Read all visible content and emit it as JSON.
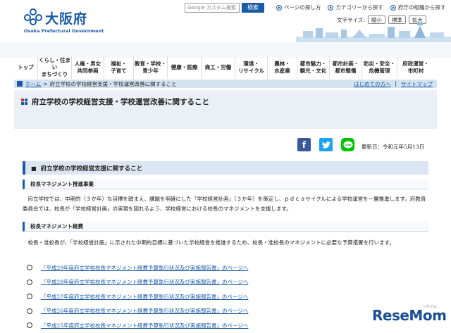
{
  "header": {
    "logo_jp": "大阪府",
    "logo_en": "Osaka Prefectural Government",
    "search_placeholder": "Google カスタム検索",
    "search_button": "検索",
    "util_links": [
      "ページの探し方",
      "カテゴリーから探す",
      "府庁の組織から探す"
    ],
    "font_size_label": "文字サイズ:",
    "font_sizes": [
      "縮小",
      "標準",
      "拡大"
    ]
  },
  "nav": {
    "items": [
      "トップ",
      "くらし・住まい\nまちづくり",
      "人権・男女\n共同参画",
      "福祉・\n子育て",
      "教育・学校・\n青少年",
      "健康・医療",
      "商工・労働",
      "環境・\nリサイクル",
      "農林・\n水産業",
      "都市魅力・\n観光・文化",
      "都市計画・\n都市整備",
      "防災・安全・\n危機管理",
      "府政運営・\n市町村"
    ]
  },
  "breadcrumb": {
    "home": "ホーム",
    "current": "府立学校の学校経営支援・学校運営改善に関すること",
    "right_links": [
      "はじめての方へ",
      "サイトマップ"
    ]
  },
  "page": {
    "title": "府立学校の学校経営支援・学校運営改善に関すること",
    "updated": "更新日：令和元年5月13日",
    "section_title": "府立学校の学校経営支援に関すること",
    "sub1_title": "校長マネジメント推進事業",
    "sub1_text": "府立学校では、中期的（３か年）な目標を踏まえ、課題を明確にした「学校経営計画」（３か年）を策定し、ｐｄｃａサイクルによる学校運営を一層推進します。府教育委員会では、校長が「学校経営計画」の実現を図れるよう、学校経営における校長のマネジメントを支援します。",
    "sub2_title": "校長マネジメント経費",
    "sub2_text": "校長・准校長が、「学校経営計画」に示された中期的目標に基づいた学校経営を推進するため、校長・准校長のマネジメントに必要な予算措置を行います。",
    "links": [
      "「平成29年度府立学校校長マネジメント経費予算執行状況及び実施報告書」のページへ",
      "「平成28年度府立学校校長マネジメント経費予算執行状況及び実施報告書」のページへ",
      "「平成27年度府立学校校長マネジメント経費予算執行状況及び実施報告書」のページへ",
      "「平成26年度府立学校校長マネジメント経費予算執行状況及び実施報告書」のページへ",
      "「平成25年度府立学校校長マネジメント経費予算執行状況及び実施報告書」のページへ"
    ]
  },
  "watermark": {
    "text": "ReseMom",
    "sub": "リセマム"
  },
  "colors": {
    "brand_blue": "#1a5aa6",
    "facebook": "#3b5998",
    "twitter": "#1da1f2",
    "line": "#00c300"
  }
}
